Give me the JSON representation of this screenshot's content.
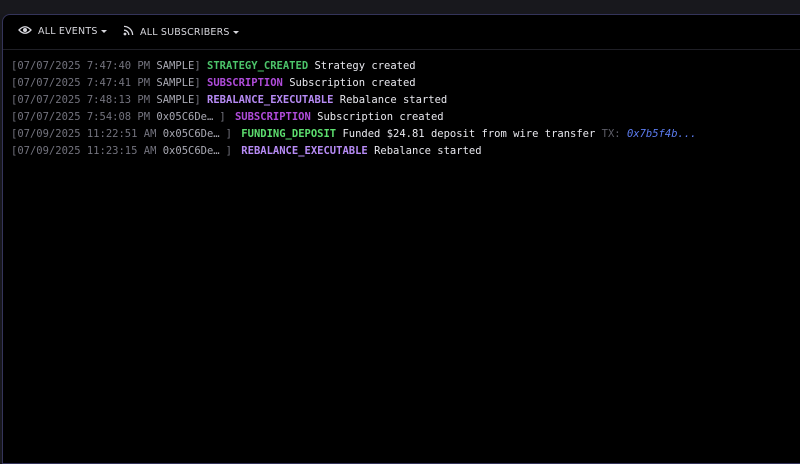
{
  "toolbar": {
    "events_label": "ALL EVENTS",
    "subscribers_label": "ALL SUBSCRIBERS"
  },
  "colors": {
    "STRATEGY_CREATED": "#4cc46a",
    "SUBSCRIPTION": "#b04cdb",
    "REBALANCE_EXECUTABLE": "#b78bf5",
    "FUNDING_DEPOSIT": "#5ddf6f"
  },
  "log": [
    {
      "time": "[07/07/2025 7:47:40 PM",
      "source": "SAMPLE",
      "close": "]",
      "event": "STRATEGY_CREATED",
      "message": "Strategy created",
      "tx_label": "",
      "tx_hash": ""
    },
    {
      "time": "[07/07/2025 7:47:41 PM",
      "source": "SAMPLE",
      "close": "]",
      "event": "SUBSCRIPTION",
      "message": "Subscription created",
      "tx_label": "",
      "tx_hash": ""
    },
    {
      "time": "[07/07/2025 7:48:13 PM",
      "source": "SAMPLE",
      "close": "]",
      "event": "REBALANCE_EXECUTABLE",
      "message": "Rebalance started",
      "tx_label": "",
      "tx_hash": ""
    },
    {
      "time": "[07/07/2025 7:54:08 PM",
      "source": "0x05C6De…",
      "close": "]",
      "event": "SUBSCRIPTION",
      "message": "Subscription created",
      "tx_label": "",
      "tx_hash": ""
    },
    {
      "time": "[07/09/2025 11:22:51 AM",
      "source": "0x05C6De…",
      "close": "]",
      "event": "FUNDING_DEPOSIT",
      "message": "Funded $24.81 deposit from wire transfer",
      "tx_label": "TX:",
      "tx_hash": "0x7b5f4b..."
    },
    {
      "time": "[07/09/2025 11:23:15 AM",
      "source": "0x05C6De…",
      "close": "]",
      "event": "REBALANCE_EXECUTABLE",
      "message": "Rebalance started",
      "tx_label": "",
      "tx_hash": ""
    }
  ]
}
